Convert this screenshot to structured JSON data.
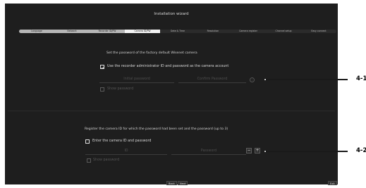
{
  "window": {
    "title": "Installation wizard"
  },
  "tabs": [
    {
      "label": "Language",
      "state": "done"
    },
    {
      "label": "Network",
      "state": "done"
    },
    {
      "label": "Recorder ID/PW",
      "state": "done"
    },
    {
      "label": "Camera ID/PW",
      "state": "active"
    },
    {
      "label": "Date & Time",
      "state": "pending"
    },
    {
      "label": "Resolution",
      "state": "pending"
    },
    {
      "label": "Camera register",
      "state": "pending"
    },
    {
      "label": "Channel setup",
      "state": "pending"
    },
    {
      "label": "Easy connect",
      "state": "pending"
    }
  ],
  "section1": {
    "heading": "Set the password of the factory default Wisenet camera",
    "use_recorder_label": "Use the recorder administrator ID and password as the camera account",
    "use_recorder_checked": true,
    "initial_password_placeholder": "Initial password",
    "confirm_password_placeholder": "Confirm Password",
    "info_glyph": "i",
    "show_password_label": "Show password"
  },
  "section2": {
    "heading": "Register the camera ID for which the password had been set and the password (up to 3)",
    "enter_id_label": "Enter the camera ID and password",
    "enter_id_checked": false,
    "id_placeholder": "ID",
    "password_placeholder": "Password",
    "minus_glyph": "−",
    "plus_glyph": "+",
    "show_password_label": "Show password"
  },
  "footer": {
    "back_label": "Back",
    "next_label": "Next",
    "exit_label": "Exit"
  },
  "callouts": {
    "first": "4-1",
    "second": "4-2"
  },
  "colors": {
    "background": "#1e1e1e",
    "active_tab": "#f2f2f2",
    "done_tab": "#b6b6b6"
  }
}
